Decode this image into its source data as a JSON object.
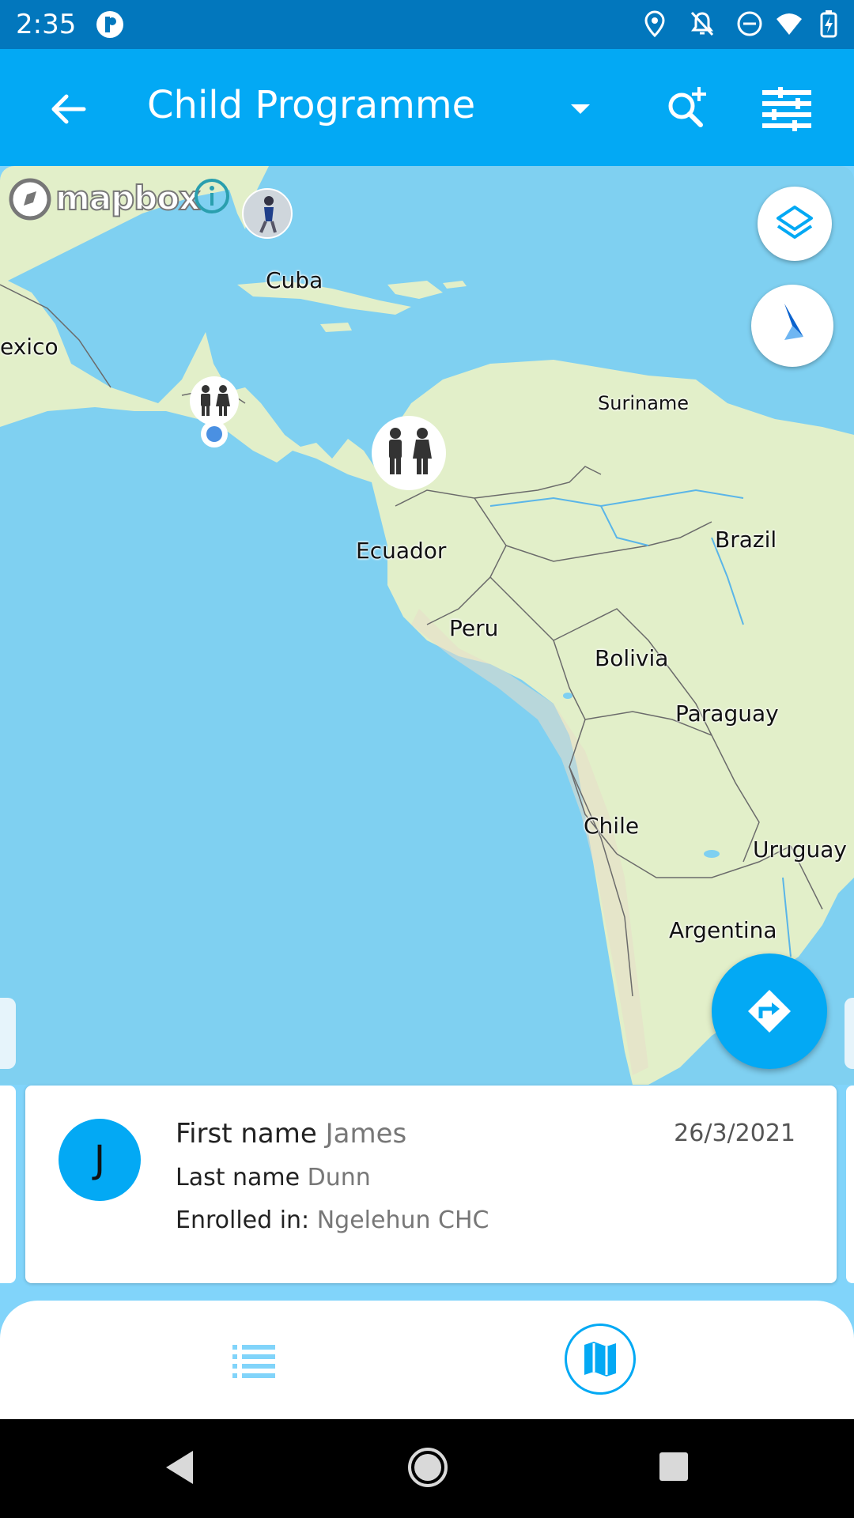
{
  "status_bar": {
    "time": "2:35",
    "icons": [
      "app-notification-icon",
      "location-icon",
      "notifications-off-icon",
      "do-not-disturb-icon",
      "wifi-icon",
      "battery-charging-icon"
    ]
  },
  "toolbar": {
    "title": "Child Programme",
    "icons": [
      "back-arrow-icon",
      "dropdown-arrow-icon",
      "search-add-icon",
      "filter-icon"
    ]
  },
  "map": {
    "attribution": "mapbox",
    "labels": {
      "cuba": "Cuba",
      "mexico": "exico",
      "suriname": "Suriname",
      "brazil": "Brazil",
      "ecuador": "Ecuador",
      "peru": "Peru",
      "bolivia": "Bolivia",
      "paraguay": "Paraguay",
      "chile": "Chile",
      "uruguay": "Uruguay",
      "argentina": "Argentina"
    },
    "colors": {
      "water": "#7FD0F1",
      "land": "#E2EFC9",
      "accent": "#03A9F4",
      "user_location": "#4A90E2"
    }
  },
  "card": {
    "avatar_letter": "J",
    "first_name_label": "First name",
    "first_name_value": "James",
    "last_name_label": "Last name",
    "last_name_value": "Dunn",
    "enrolled_label": "Enrolled in:",
    "enrolled_value": "Ngelehun CHC",
    "date": "26/3/2021"
  },
  "bottom_nav": {
    "items": [
      {
        "icon": "list-icon",
        "selected": false
      },
      {
        "icon": "map-icon",
        "selected": true
      }
    ]
  }
}
